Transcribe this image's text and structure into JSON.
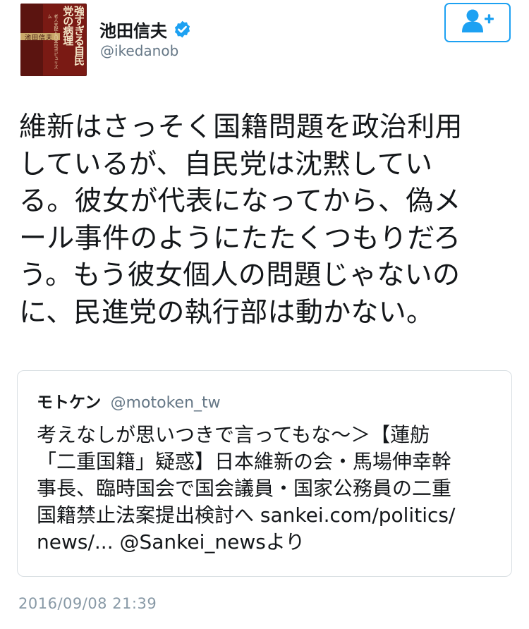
{
  "profile": {
    "display_name": "池田信夫",
    "handle": "@ikedanob",
    "avatar": {
      "book_title": "強すぎる自民党の病理",
      "book_subtitle": "老人支配と日本型ポピュリズム",
      "author": "池田信夫"
    },
    "verified_icon": "verified-badge-icon",
    "follow_icon": "add-user-icon"
  },
  "tweet": {
    "lines": [
      "維新はさっそく国籍問題を政治利用",
      "しているが、自民党は沈黙してい",
      "る。彼女が代表になってから、偽メ",
      "ール事件のようにたたくつもりだろ",
      "う。もう彼女個人の問題じゃないの",
      "に、民進党の執行部は動かない。"
    ],
    "timestamp": "2016/09/08 21:39"
  },
  "quoted_tweet": {
    "display_name": "モトケン",
    "handle": "@motoken_tw",
    "lines": [
      "考えなしが思いつきで言ってもな～＞【蓮舫",
      "「二重国籍」疑惑】日本維新の会・馬場伸幸幹",
      "事長、臨時国会で国会議員・国家公務員の二重",
      "国籍禁止法案提出検討へ sankei.com/politics/",
      "news/... @Sankei_newsより"
    ]
  },
  "colors": {
    "accent": "#1da1f2",
    "text": "#14171a",
    "secondary": "#657786",
    "timestamp": "#8899a6",
    "border": "#d9dfe3"
  }
}
